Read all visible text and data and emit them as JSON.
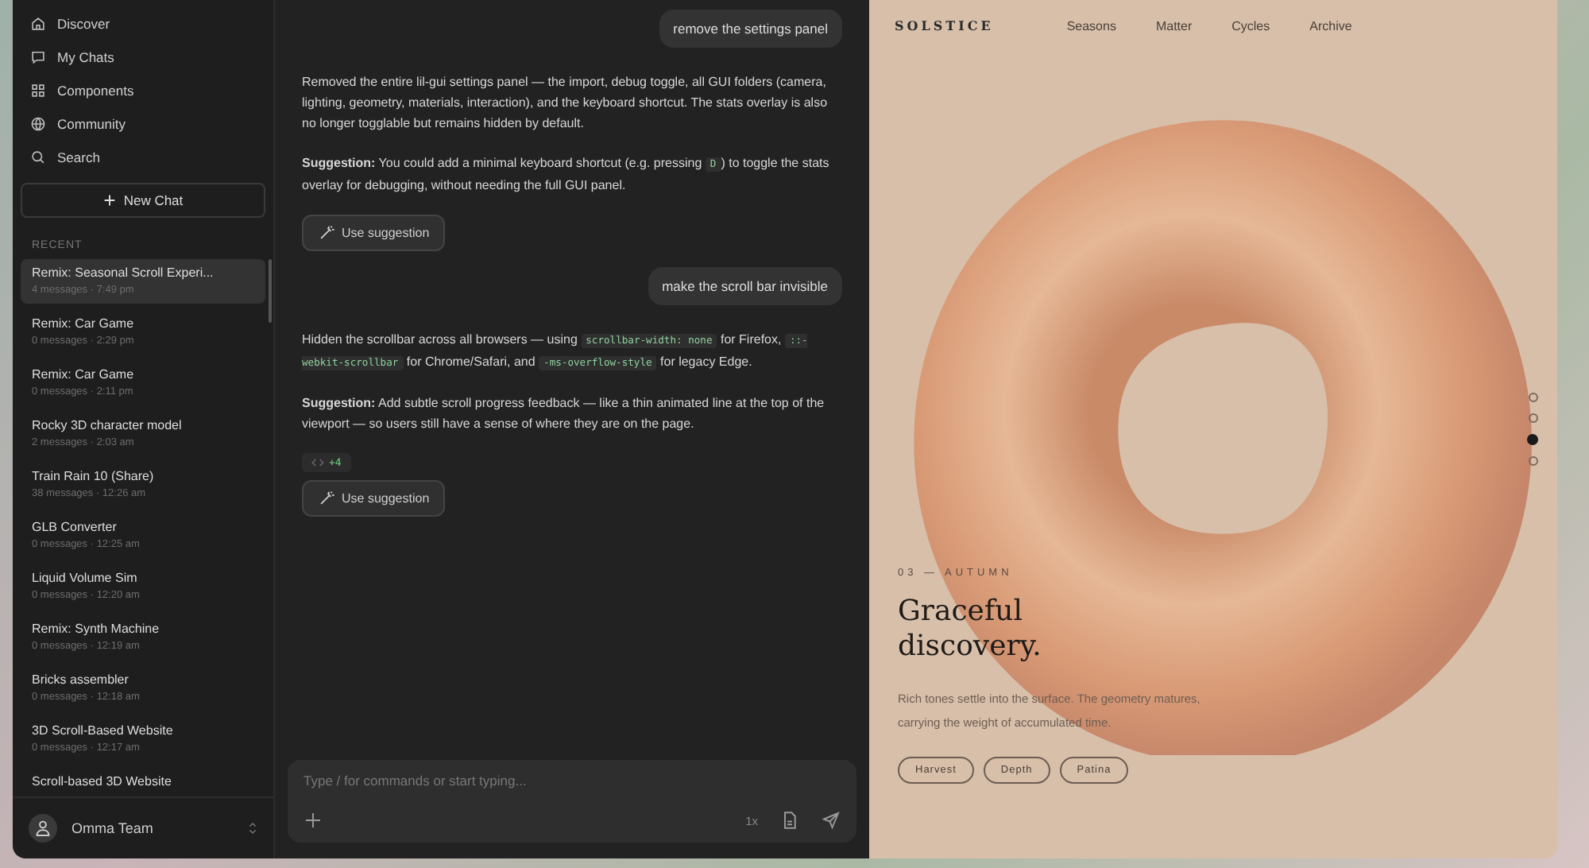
{
  "sidebar": {
    "nav": [
      {
        "label": "Discover"
      },
      {
        "label": "My Chats"
      },
      {
        "label": "Components"
      },
      {
        "label": "Community"
      },
      {
        "label": "Search"
      }
    ],
    "new_chat": "New Chat",
    "recent_heading": "RECENT",
    "chats": [
      {
        "title": "Remix: Seasonal Scroll Experi...",
        "meta": "4 messages · 7:49 pm",
        "selected": true
      },
      {
        "title": "Remix: Car Game",
        "meta": "0 messages · 2:29 pm",
        "selected": false
      },
      {
        "title": "Remix: Car Game",
        "meta": "0 messages · 2:11 pm",
        "selected": false
      },
      {
        "title": "Rocky 3D character model",
        "meta": "2 messages · 2:03 am",
        "selected": false
      },
      {
        "title": "Train Rain 10 (Share)",
        "meta": "38 messages · 12:26 am",
        "selected": false
      },
      {
        "title": "GLB Converter",
        "meta": "0 messages · 12:25 am",
        "selected": false
      },
      {
        "title": "Liquid Volume Sim",
        "meta": "0 messages · 12:20 am",
        "selected": false
      },
      {
        "title": "Remix: Synth Machine",
        "meta": "0 messages · 12:19 am",
        "selected": false
      },
      {
        "title": "Bricks assembler",
        "meta": "0 messages · 12:18 am",
        "selected": false
      },
      {
        "title": "3D Scroll-Based Website",
        "meta": "0 messages · 12:17 am",
        "selected": false
      },
      {
        "title": "Scroll-based 3D Website",
        "selected": false
      }
    ],
    "user": "Omma Team"
  },
  "chat": {
    "messages": [
      {
        "kind": "user",
        "text": "remove the settings panel"
      },
      {
        "kind": "assistant",
        "paragraphs": [
          [
            {
              "kind": "text",
              "text": "Removed the entire lil-gui settings panel — the import, debug toggle, all GUI folders (camera, lighting, geometry, materials, interaction), and the keyboard shortcut. The stats overlay is also no longer togglable but remains hidden by default."
            }
          ],
          [
            {
              "kind": "text",
              "text": "**Suggestion:** You could add a minimal keyboard shortcut (e.g. pressing "
            },
            {
              "kind": "code",
              "text": "D"
            },
            {
              "kind": "text",
              "text": ") to toggle the stats overlay for debugging, without needing the full GUI panel."
            }
          ]
        ],
        "button": "Use suggestion"
      },
      {
        "kind": "user",
        "text": "make the scroll bar invisible"
      },
      {
        "kind": "assistant",
        "paragraphs": [
          [
            {
              "kind": "text",
              "text": "Hidden the scrollbar across all browsers — using "
            },
            {
              "kind": "code",
              "text": "scrollbar-width: none"
            },
            {
              "kind": "text",
              "text": " for Firefox, "
            },
            {
              "kind": "code",
              "text": "::-webkit-scrollbar"
            },
            {
              "kind": "text",
              "text": " for Chrome/Safari, and "
            },
            {
              "kind": "code",
              "text": "-ms-overflow-style"
            },
            {
              "kind": "text",
              "text": " for legacy Edge."
            }
          ],
          [
            {
              "kind": "text",
              "text": "**Suggestion:** Add subtle scroll progress feedback — like a thin animated line at the top of the viewport — so users still have a sense of where they are on the page."
            }
          ]
        ],
        "diff": "+4",
        "button": "Use suggestion"
      }
    ],
    "composer": {
      "placeholder": "Type / for commands or start typing...",
      "speed": "1x"
    }
  },
  "preview": {
    "logo": "SOLSTICE",
    "nav": [
      "Seasons",
      "Matter",
      "Cycles",
      "Archive"
    ],
    "dots": [
      {
        "selected": false
      },
      {
        "selected": false
      },
      {
        "selected": true
      },
      {
        "selected": false
      }
    ],
    "eyebrow": "03 — AUTUMN",
    "headline": [
      "Graceful",
      "discovery."
    ],
    "body": "Rich tones settle into the surface. The geometry matures, carrying the weight of accumulated time.",
    "tags": [
      "Harvest",
      "Depth",
      "Patina"
    ]
  }
}
